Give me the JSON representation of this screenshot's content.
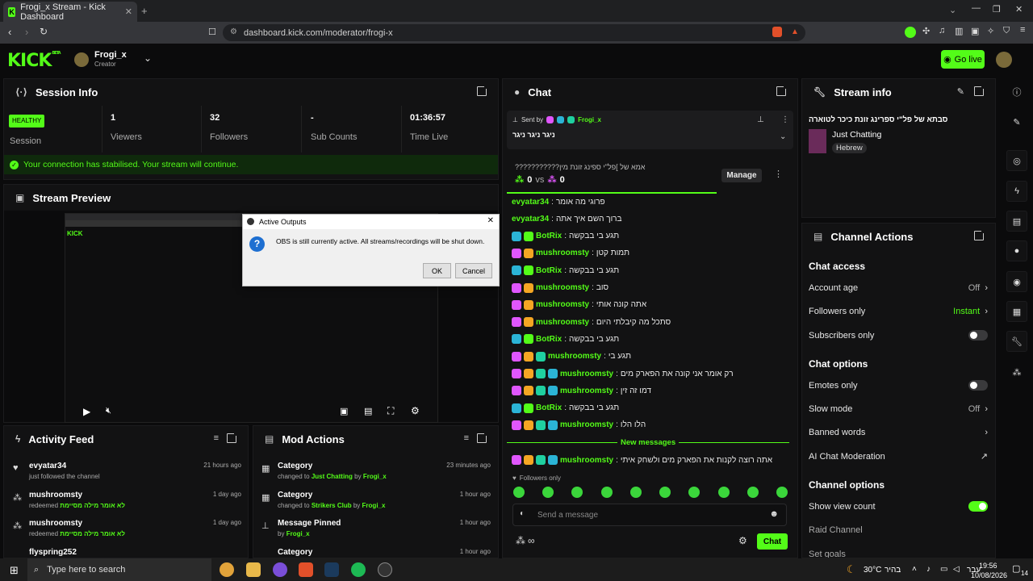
{
  "browser": {
    "tab_title": "Frogi_x Stream - Kick Dashboard",
    "url": "dashboard.kick.com/moderator/frogi-x"
  },
  "header": {
    "logo": "KICK",
    "beta": "BETA",
    "username": "Frogi_x",
    "role": "Creator",
    "go_live": "Go live"
  },
  "session": {
    "title": "Session Info",
    "status_badge": "HEALTHY",
    "stats": [
      {
        "value": "",
        "label": "Session"
      },
      {
        "value": "1",
        "label": "Viewers"
      },
      {
        "value": "32",
        "label": "Followers"
      },
      {
        "value": "-",
        "label": "Sub Counts"
      },
      {
        "value": "01:36:57",
        "label": "Time Live"
      }
    ],
    "notice": "Your connection has stabilised. Your stream will continue."
  },
  "preview": {
    "title": "Stream Preview"
  },
  "dialog": {
    "title": "Active Outputs",
    "message": "OBS is still currently active. All streams/recordings will be shut down.",
    "ok": "OK",
    "cancel": "Cancel"
  },
  "activity": {
    "title": "Activity Feed",
    "items": [
      {
        "name": "evyatar34",
        "sub": "just followed the channel",
        "highlight": "",
        "ago": "21 hours ago"
      },
      {
        "name": "mushroomsty",
        "sub": "redeemed",
        "highlight": "לא אומר מילה מסיימת",
        "ago": "1 day ago"
      },
      {
        "name": "mushroomsty",
        "sub": "redeemed",
        "highlight": "לא אומר מילה מסיימת",
        "ago": "1 day ago"
      },
      {
        "name": "flyspring252",
        "sub": "",
        "highlight": "",
        "ago": ""
      }
    ]
  },
  "mod_actions": {
    "title": "Mod Actions",
    "items": [
      {
        "name": "Category",
        "pre": "changed to",
        "target": "Just Chatting",
        "by": "by",
        "user": "Frogi_x",
        "ago": "23 minutes ago"
      },
      {
        "name": "Category",
        "pre": "changed to",
        "target": "Strikers Club",
        "by": "by",
        "user": "Frogi_x",
        "ago": "1 hour ago"
      },
      {
        "name": "Message Pinned",
        "pre": "",
        "target": "",
        "by": "by",
        "user": "Frogi_x",
        "ago": "1 hour ago"
      },
      {
        "name": "Category",
        "pre": "",
        "target": "",
        "by": "",
        "user": "",
        "ago": "1 hour ago"
      }
    ]
  },
  "chat": {
    "title": "Chat",
    "pinned_sent_by": "Sent by",
    "pinned_user": "Frogi_x",
    "pinned_text": "ניגר ניגר ניגר",
    "poll_question": "???????????אמא של ]פל\"י ספינג זונת מין",
    "poll_left": "0",
    "poll_vs": "vs",
    "poll_right": "0",
    "manage": "Manage",
    "messages": [
      {
        "user": "evyatar34",
        "color": "#53fc18",
        "text": "פרוגי מה אומר",
        "icons": 0
      },
      {
        "user": "evyatar34",
        "color": "#53fc18",
        "text": "ברוך השם איך אתה",
        "icons": 0
      },
      {
        "user": "BotRix",
        "color": "#53fc18",
        "text": "תגע בי בבקשה",
        "icons": 2
      },
      {
        "user": "mushroomsty",
        "color": "#53fc18",
        "text": "תמות קטן",
        "icons": 2
      },
      {
        "user": "BotRix",
        "color": "#53fc18",
        "text": "תגע בי בבקשה",
        "icons": 2
      },
      {
        "user": "mushroomsty",
        "color": "#53fc18",
        "text": "סוב",
        "icons": 2
      },
      {
        "user": "mushroomsty",
        "color": "#53fc18",
        "text": "אתה קונה אותי",
        "icons": 2
      },
      {
        "user": "mushroomsty",
        "color": "#53fc18",
        "text": "סתכל מה קיבלתי היום",
        "icons": 2
      },
      {
        "user": "BotRix",
        "color": "#53fc18",
        "text": "תגע בי בבקשה",
        "icons": 2
      },
      {
        "user": "mushroomsty",
        "color": "#53fc18",
        "text": "תגע בי",
        "icons": 3
      },
      {
        "user": "mushroomsty",
        "color": "#53fc18",
        "text": "רק אומר אני קונה את הפארק מים",
        "icons": 4
      },
      {
        "user": "mushroomsty",
        "color": "#53fc18",
        "text": "דמו זה זין",
        "icons": 4
      },
      {
        "user": "BotRix",
        "color": "#53fc18",
        "text": "תגע בי בבקשה",
        "icons": 2
      },
      {
        "user": "mushroomsty",
        "color": "#53fc18",
        "text": "הלו הלו",
        "icons": 4
      }
    ],
    "new_messages": "New messages",
    "last_message": {
      "user": "mushroomsty",
      "text": "אתה רוצה לקנות את הפארק מים ולשחק איתי"
    },
    "followers_only": "Followers only",
    "placeholder": "Send a message",
    "infinity": "∞",
    "send": "Chat"
  },
  "stream_info": {
    "title": "Stream info",
    "stream_title": "סבתא של פל\"י ספרינג זונת כיכר לטוארה",
    "category": "Just Chatting",
    "language": "Hebrew"
  },
  "channel_actions": {
    "title": "Channel Actions",
    "chat_access": "Chat access",
    "account_age": {
      "label": "Account age",
      "value": "Off"
    },
    "followers_only": {
      "label": "Followers only",
      "value": "Instant"
    },
    "subscribers_only": {
      "label": "Subscribers only"
    },
    "chat_options": "Chat options",
    "emotes_only": {
      "label": "Emotes only"
    },
    "slow_mode": {
      "label": "Slow mode",
      "value": "Off"
    },
    "banned_words": {
      "label": "Banned words"
    },
    "ai_moderation": {
      "label": "AI Chat Moderation"
    },
    "channel_options": "Channel options",
    "show_view_count": {
      "label": "Show view count"
    },
    "raid_channel": {
      "label": "Raid Channel"
    },
    "set_goals": {
      "label": "Set goals"
    }
  },
  "taskbar": {
    "search": "Type here to search",
    "weather": "30°C",
    "weather_label": "בהיר",
    "lang": "עבר",
    "time": "19:56",
    "date": "10/08/2026",
    "notif": "14"
  },
  "colors": {
    "accent": "#53fc18",
    "panel": "#121213",
    "bg": "#0b0b0c"
  }
}
